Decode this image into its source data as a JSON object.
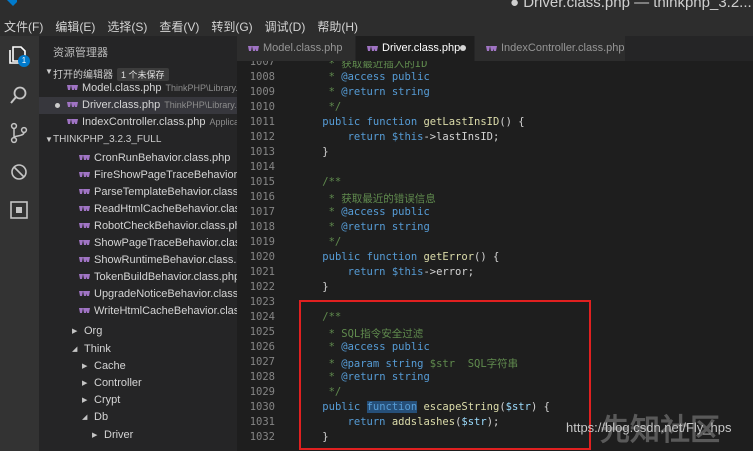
{
  "window": {
    "title": "● Driver.class.php — thinkphp_3.2..."
  },
  "menu": [
    "文件(F)",
    "编辑(E)",
    "选择(S)",
    "查看(V)",
    "转到(G)",
    "调试(D)",
    "帮助(H)"
  ],
  "activity_bar": {
    "icons": [
      "files-icon",
      "search-icon",
      "source-control-icon",
      "debug-icon",
      "extensions-icon"
    ],
    "files_badge": "1"
  },
  "sidebar": {
    "title": "资源管理器",
    "open_editors": {
      "label": "打开的编辑器",
      "badge": "1 个未保存",
      "items": [
        {
          "name": "Model.class.php",
          "path": "ThinkPHP\\Library...",
          "modified": false,
          "active": false
        },
        {
          "name": "Driver.class.php",
          "path": "ThinkPHP\\Library...",
          "modified": true,
          "active": true
        },
        {
          "name": "IndexController.class.php",
          "path": "Applica...",
          "modified": false,
          "active": false
        }
      ]
    },
    "project": {
      "label": "THINKPHP_3.2.3_FULL",
      "files": [
        "CronRunBehavior.class.php",
        "FireShowPageTraceBehavior.c...",
        "ParseTemplateBehavior.class.p...",
        "ReadHtmlCacheBehavior.class...",
        "RobotCheckBehavior.class.php",
        "ShowPageTraceBehavior.class....",
        "ShowRuntimeBehavior.class.p...",
        "TokenBuildBehavior.class.php",
        "UpgradeNoticeBehavior.class....",
        "WriteHtmlCacheBehavior.class..."
      ],
      "folders": [
        {
          "name": "Org",
          "state": "collapsed",
          "level": 1
        },
        {
          "name": "Think",
          "state": "expanded",
          "level": 1
        },
        {
          "name": "Cache",
          "state": "collapsed",
          "level": 2
        },
        {
          "name": "Controller",
          "state": "collapsed",
          "level": 2
        },
        {
          "name": "Crypt",
          "state": "collapsed",
          "level": 2
        },
        {
          "name": "Db",
          "state": "expanded",
          "level": 2
        },
        {
          "name": "Driver",
          "state": "collapsed",
          "level": 3
        }
      ]
    }
  },
  "tabs": [
    {
      "name": "Model.class.php",
      "active": false,
      "modified": false
    },
    {
      "name": "Driver.class.php",
      "active": true,
      "modified": true
    },
    {
      "name": "IndexController.class.php",
      "active": false,
      "modified": false
    }
  ],
  "editor": {
    "lines": [
      {
        "n": "1007",
        "code": "     * 获取最近插入的ID"
      },
      {
        "n": "1008",
        "code": "     * @access public"
      },
      {
        "n": "1009",
        "code": "     * @return string"
      },
      {
        "n": "1010",
        "code": "     */"
      },
      {
        "n": "1011",
        "code": "    public function getLastInsID() {"
      },
      {
        "n": "1012",
        "code": "        return $this->lastInsID;"
      },
      {
        "n": "1013",
        "code": "    }"
      },
      {
        "n": "1014",
        "code": ""
      },
      {
        "n": "1015",
        "code": "    /**"
      },
      {
        "n": "1016",
        "code": "     * 获取最近的错误信息"
      },
      {
        "n": "1017",
        "code": "     * @access public"
      },
      {
        "n": "1018",
        "code": "     * @return string"
      },
      {
        "n": "1019",
        "code": "     */"
      },
      {
        "n": "1020",
        "code": "    public function getError() {"
      },
      {
        "n": "1021",
        "code": "        return $this->error;"
      },
      {
        "n": "1022",
        "code": "    }"
      },
      {
        "n": "1023",
        "code": ""
      },
      {
        "n": "1024",
        "code": "    /**"
      },
      {
        "n": "1025",
        "code": "     * SQL指令安全过滤"
      },
      {
        "n": "1026",
        "code": "     * @access public"
      },
      {
        "n": "1027",
        "code": "     * @param string $str  SQL字符串"
      },
      {
        "n": "1028",
        "code": "     * @return string"
      },
      {
        "n": "1029",
        "code": "     */"
      },
      {
        "n": "1030",
        "code": "    public function escapeString($str) {"
      },
      {
        "n": "1031",
        "code": "        return addslashes($str);"
      },
      {
        "n": "1032",
        "code": "    }"
      }
    ]
  },
  "watermark": {
    "url": "https://blog.csdn.net/Fly_hps",
    "brand": "先知社区"
  },
  "colors": {
    "comment": "#608b4e",
    "keyword": "#569cd6",
    "function": "#dcdcaa",
    "variable": "#9cdcfe",
    "highlight_box": "#e02020"
  }
}
